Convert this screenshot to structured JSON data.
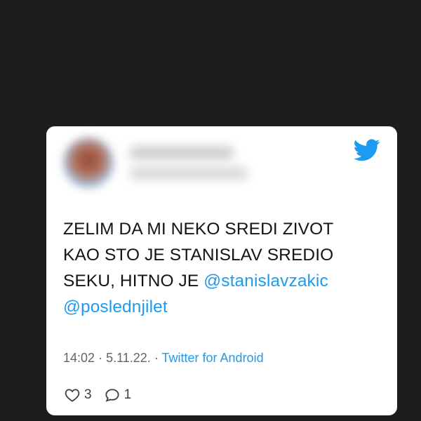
{
  "tweet": {
    "text_line1": "ZELIM DA MI NEKO SREDI ZIVOT",
    "text_line2": "KAO STO JE STANISLAV SREDIO",
    "text_line3_prefix": "SEKU, HITNO JE",
    "mention1": "@stanislavzakic",
    "mention2": "@poslednjilet",
    "time": "14:02",
    "date": "5.11.22.",
    "separator": "·",
    "source": "Twitter for Android",
    "likes": "3",
    "replies": "1"
  },
  "colors": {
    "background": "#1d1d1d",
    "card": "#ffffff",
    "accent": "#1d9bf0",
    "text": "#141414",
    "meta": "#5b6670"
  },
  "icons": {
    "brand": "twitter-bird-icon",
    "like": "heart-icon",
    "reply": "comment-icon"
  }
}
